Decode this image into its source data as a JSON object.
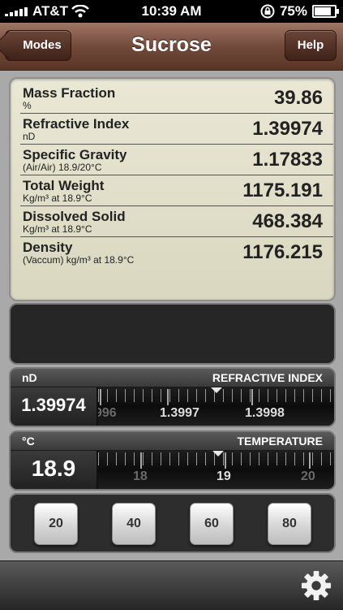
{
  "status_bar": {
    "carrier": "AT&T",
    "time": "10:39 AM",
    "battery_percent": "75%",
    "battery_level": 0.75,
    "icons": [
      "signal-icon",
      "wifi-icon",
      "rotation-lock-icon",
      "battery-icon"
    ]
  },
  "nav": {
    "title": "Sucrose",
    "left_button": "Modes",
    "right_button": "Help"
  },
  "readouts": [
    {
      "label": "Mass Fraction",
      "sub": "%",
      "value": "39.86"
    },
    {
      "label": "Refractive Index",
      "sub": "nD",
      "value": "1.39974"
    },
    {
      "label": "Specific Gravity",
      "sub": "(Air/Air) 18.9/20°C",
      "value": "1.17833"
    },
    {
      "label": "Total Weight",
      "sub": "Kg/m³ at 18.9°C",
      "value": "1175.191"
    },
    {
      "label": "Dissolved Solid",
      "sub": "Kg/m³ at 18.9°C",
      "value": "468.384"
    },
    {
      "label": "Density",
      "sub": "(Vaccum) kg/m³ at 18.9°C",
      "value": "1176.215"
    }
  ],
  "refractive_slider": {
    "unit": "nD",
    "title": "REFRACTIVE INDEX",
    "value": "1.39974",
    "scale_labels": [
      "996",
      "1.3997",
      "1.3998"
    ]
  },
  "temperature_slider": {
    "unit": "°C",
    "title": "TEMPERATURE",
    "value": "18.9",
    "scale_labels": [
      "18",
      "19",
      "20"
    ]
  },
  "presets": [
    "20",
    "40",
    "60",
    "80"
  ],
  "toolbar": {
    "settings_icon": "gear-icon"
  },
  "colors": {
    "nav_brown": "#6e4738",
    "readout_bg": "#e2e0cb",
    "panel_dark": "#2d2d2d"
  }
}
